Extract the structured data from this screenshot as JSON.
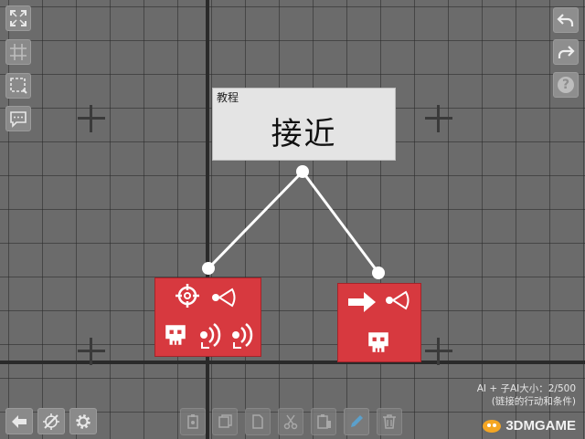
{
  "left_toolbar": {
    "icons": [
      "fullscreen-icon",
      "grid-icon",
      "select-box-icon",
      "comment-icon"
    ]
  },
  "right_toolbar": {
    "icons": [
      "undo-icon",
      "redo-icon",
      "help-icon"
    ],
    "help_label": "?"
  },
  "main_node": {
    "tag": "教程",
    "title": "接近"
  },
  "action_cards": [
    {
      "icons": [
        "target-icon",
        "sight-icon",
        "skull-icon",
        "hearing-icon",
        "hearing-icon"
      ]
    },
    {
      "icons": [
        "arrow-right-icon",
        "sight-icon",
        "skull-icon"
      ]
    }
  ],
  "bottom_left": {
    "icons": [
      "back-arrow-icon",
      "disable-node-icon",
      "settings-icon"
    ]
  },
  "bottom_toolbar": {
    "icons": [
      "paste-icon",
      "copy-icon",
      "duplicate-icon",
      "cut-icon",
      "paste-special-icon",
      "edit-icon",
      "delete-icon"
    ]
  },
  "ai_size": {
    "line1": "AI + 子AI大小：2/500",
    "line2": "(链接的行动和条件)"
  },
  "watermark": {
    "text": "3DMGAME"
  },
  "colors": {
    "background": "#6b6b6b",
    "action_red": "#d7393f",
    "node_bg": "#e4e4e4",
    "link_white": "#ffffff"
  }
}
